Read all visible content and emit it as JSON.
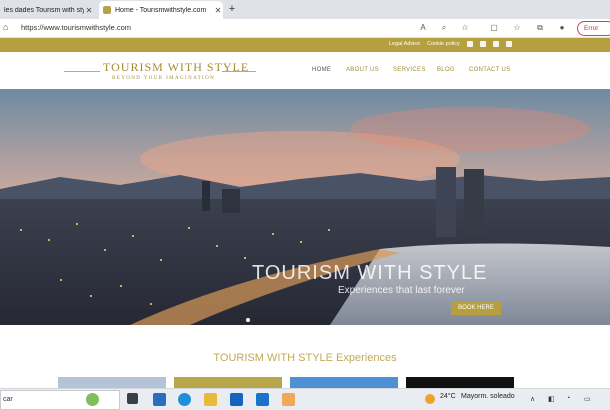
{
  "browser": {
    "tabs": [
      {
        "title": "les dades Tourism with sty"
      },
      {
        "title": "Home - Tourismwithstyle.com"
      }
    ],
    "url": "https://www.tourismwithstyle.com",
    "error_label": "Error"
  },
  "site": {
    "top_links": [
      "Legal Advice",
      "Cookie policy"
    ],
    "logo_title": "TOURISM WITH STYLE",
    "logo_subtitle": "BEYOND YOUR IMAGINATION",
    "nav": [
      "HOME",
      "ABOUT US",
      "SERVICES",
      "BLOG",
      "CONTACT US"
    ],
    "hero": {
      "title": "TOURISM WITH STYLE",
      "subtitle": "Experiences that last forever",
      "cta": "BOOK HERE"
    },
    "experiences_title": "TOURISM WITH STYLE Experiences"
  },
  "taskbar": {
    "search_text": "car",
    "weather_temp": "24°C",
    "weather_desc": "Mayorm. soleado"
  },
  "colors": {
    "gold": "#b59f3e",
    "gold_text": "#a38c35"
  }
}
